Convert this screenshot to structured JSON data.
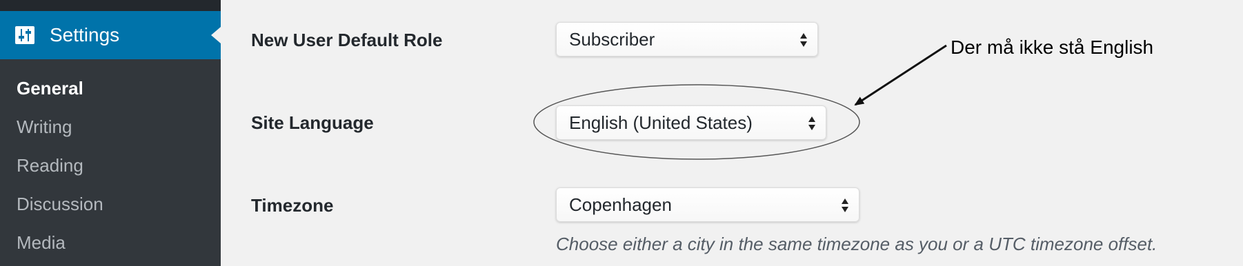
{
  "sidebar": {
    "menu_label": "Settings",
    "menu_icon": "settings-sliders-icon",
    "items": [
      {
        "label": "General",
        "current": true
      },
      {
        "label": "Writing",
        "current": false
      },
      {
        "label": "Reading",
        "current": false
      },
      {
        "label": "Discussion",
        "current": false
      },
      {
        "label": "Media",
        "current": false
      }
    ]
  },
  "form": {
    "default_role": {
      "label": "New User Default Role",
      "value": "Subscriber"
    },
    "site_language": {
      "label": "Site Language",
      "value": "English (United States)"
    },
    "timezone": {
      "label": "Timezone",
      "value": "Copenhagen",
      "description": "Choose either a city in the same timezone as you or a UTC timezone offset."
    }
  },
  "annotation": {
    "text": "Der må ikke stå English"
  },
  "colors": {
    "sidebar_bg": "#32373c",
    "active_bg": "#0073aa",
    "content_bg": "#f1f1f1"
  }
}
